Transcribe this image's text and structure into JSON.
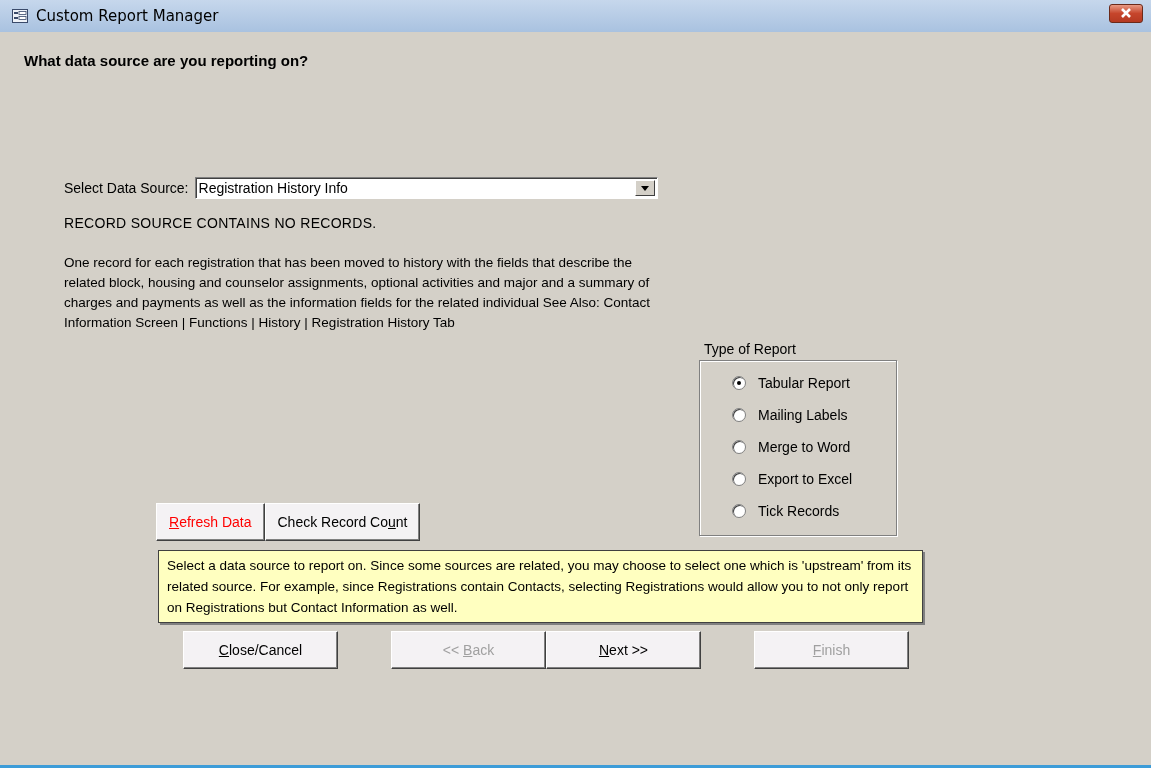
{
  "window": {
    "title": "Custom Report Manager"
  },
  "heading": "What data source are you reporting on?",
  "data_source": {
    "label": "Select Data Source:",
    "value": "Registration History Info"
  },
  "record_status": "RECORD SOURCE CONTAINS NO RECORDS.",
  "description": "One record for each registration that has been moved to history with the fields that describe the related block, housing and counselor assignments, optional activities and major and a summary of charges and payments as well as the information fields for the related individual  See Also: Contact Information Screen | Functions | History | Registration History Tab",
  "tool_buttons": [
    {
      "key": "R",
      "after": "efresh Data",
      "color": "#ff0000"
    },
    {
      "before": "Check Record Co",
      "key": "u",
      "after": "nt",
      "color": "#000000"
    }
  ],
  "report_type": {
    "label": "Type of Report",
    "options": [
      {
        "label": "Tabular Report",
        "selected": true
      },
      {
        "label": "Mailing Labels",
        "selected": false
      },
      {
        "label": "Merge to Word",
        "selected": false
      },
      {
        "label": "Export to Excel",
        "selected": false
      },
      {
        "label": "Tick Records",
        "selected": false
      }
    ]
  },
  "help_text": "Select a data source to report on.  Since some sources are related, you may choose to select one which is 'upstream' from its related source.  For example, since Registrations contain Contacts, selecting Registrations would allow you to not only report on Registrations but Contact Information as well.",
  "nav_buttons": [
    {
      "key": "C",
      "after": "lose/Cancel",
      "disabled": false
    },
    {
      "before": "<< ",
      "key": "B",
      "after": "ack",
      "disabled": true
    },
    {
      "key": "N",
      "after": "ext >>",
      "disabled": false
    },
    {
      "key": "F",
      "after": "inish",
      "disabled": true
    }
  ]
}
